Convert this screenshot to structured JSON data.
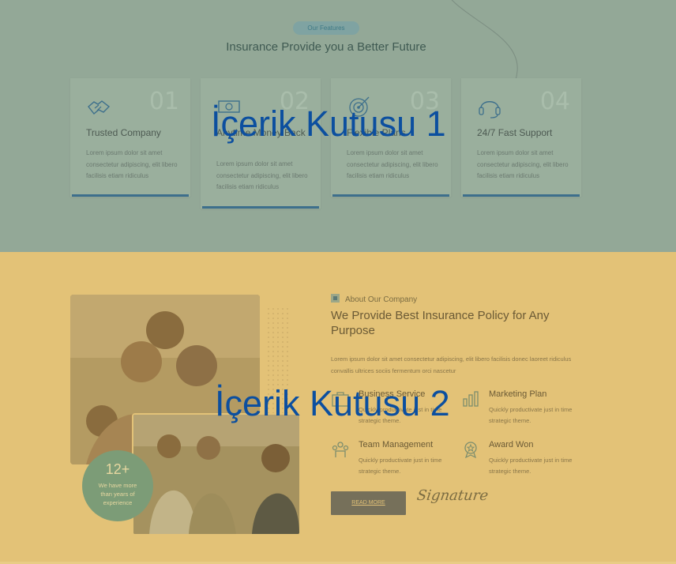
{
  "features": {
    "badge": "Our Features",
    "title": "Insurance Provide you a Better Future",
    "cards": [
      {
        "num": "01",
        "title": "Trusted Company",
        "desc": "Lorem ipsum dolor sit amet consectetur adipiscing, elit libero facilisis etiam ridiculus",
        "icon": "handshake-icon"
      },
      {
        "num": "02",
        "title": "Anytime Money Back",
        "desc": "Lorem ipsum dolor sit amet consectetur adipiscing, elit libero facilisis etiam ridiculus",
        "icon": "money-icon"
      },
      {
        "num": "03",
        "title": "Flexible Plans",
        "desc": "Lorem ipsum dolor sit amet consectetur adipiscing, elit libero facilisis etiam ridiculus",
        "icon": "target-icon"
      },
      {
        "num": "04",
        "title": "24/7 Fast Support",
        "desc": "Lorem ipsum dolor sit amet consectetur adipiscing, elit libero facilisis etiam ridiculus",
        "icon": "headset-icon"
      }
    ]
  },
  "overlay": {
    "label1": "İçerik Kutusu 1",
    "label2": "İçerik Kutusu 2"
  },
  "about": {
    "tag": "About Our Company",
    "title": "We Provide Best Insurance Policy for Any Purpose",
    "desc": "Lorem ipsum dolor sit amet consectetur adipiscing, elit libero facilisis donec laoreet ridiculus convallis ultrices sociis fermentum orci nascetur",
    "experience": {
      "big": "12+",
      "small": "We have more than years of experience"
    },
    "items": [
      {
        "title": "Business Service",
        "desc": "Quickly productivate just in time strategic theme.",
        "icon": "briefcase-icon"
      },
      {
        "title": "Marketing Plan",
        "desc": "Quickly productivate just in time strategic theme.",
        "icon": "chart-icon"
      },
      {
        "title": "Team Management",
        "desc": "Quickly productivate just in time strategic theme.",
        "icon": "team-icon"
      },
      {
        "title": "Award Won",
        "desc": "Quickly productivate just in time strategic theme.",
        "icon": "award-icon"
      }
    ],
    "read_more": "READ MORE",
    "signature": "Signature"
  }
}
